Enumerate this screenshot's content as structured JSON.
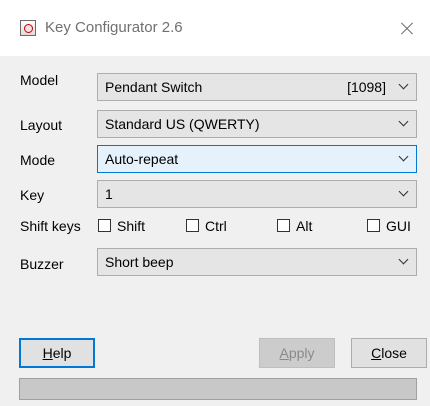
{
  "window": {
    "title": "Key Configurator 2.6",
    "app_icon": "red-q-app-icon",
    "close_icon": "close-x-icon"
  },
  "form": {
    "model": {
      "label": "Model",
      "value": "Pendant Switch",
      "extra": "[1098]"
    },
    "layout": {
      "label": "Layout",
      "value": "Standard US (QWERTY)"
    },
    "mode": {
      "label": "Mode",
      "value": "Auto-repeat"
    },
    "key": {
      "label": "Key",
      "value": "1"
    },
    "shift_keys": {
      "label": "Shift keys",
      "shift": {
        "label": "Shift",
        "checked": false
      },
      "ctrl": {
        "label": "Ctrl",
        "checked": false
      },
      "alt": {
        "label": "Alt",
        "checked": false
      },
      "gui": {
        "label": "GUI",
        "checked": false
      }
    },
    "buzzer": {
      "label": "Buzzer",
      "value": "Short beep"
    }
  },
  "buttons": {
    "help": {
      "mnemonic": "H",
      "rest": "elp"
    },
    "apply": {
      "mnemonic": "A",
      "rest": "pply",
      "enabled": false
    },
    "close": {
      "mnemonic": "C",
      "rest": "lose"
    }
  },
  "status_bar": {
    "text": ""
  },
  "colors": {
    "focus_accent": "#0078d7",
    "dialog_background": "#f0f0f0"
  }
}
